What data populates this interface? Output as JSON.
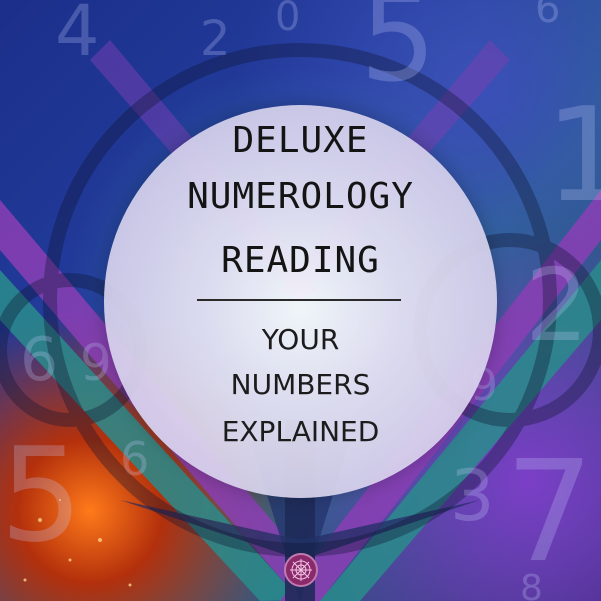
{
  "title": {
    "line1": "DELUXE",
    "line2": "NUMEROLOGY",
    "line3": "READING"
  },
  "subtitle": {
    "line1": "YOUR",
    "line2": "NUMBERS",
    "line3": "EXPLAINED"
  },
  "background": {
    "digits": [
      "4",
      "2",
      "0",
      "5",
      "6",
      "1",
      "6",
      "9",
      "2",
      "9",
      "5",
      "6",
      "3",
      "7",
      "8"
    ]
  },
  "colors": {
    "deep_blue": "#1b2f8a",
    "purple": "#7b3fc7",
    "teal": "#2b8a8a",
    "orange": "#ff7a1a",
    "circle": "#e6e2f4",
    "text": "#141414"
  },
  "logo": {
    "icon": "mandala-logo-icon"
  }
}
